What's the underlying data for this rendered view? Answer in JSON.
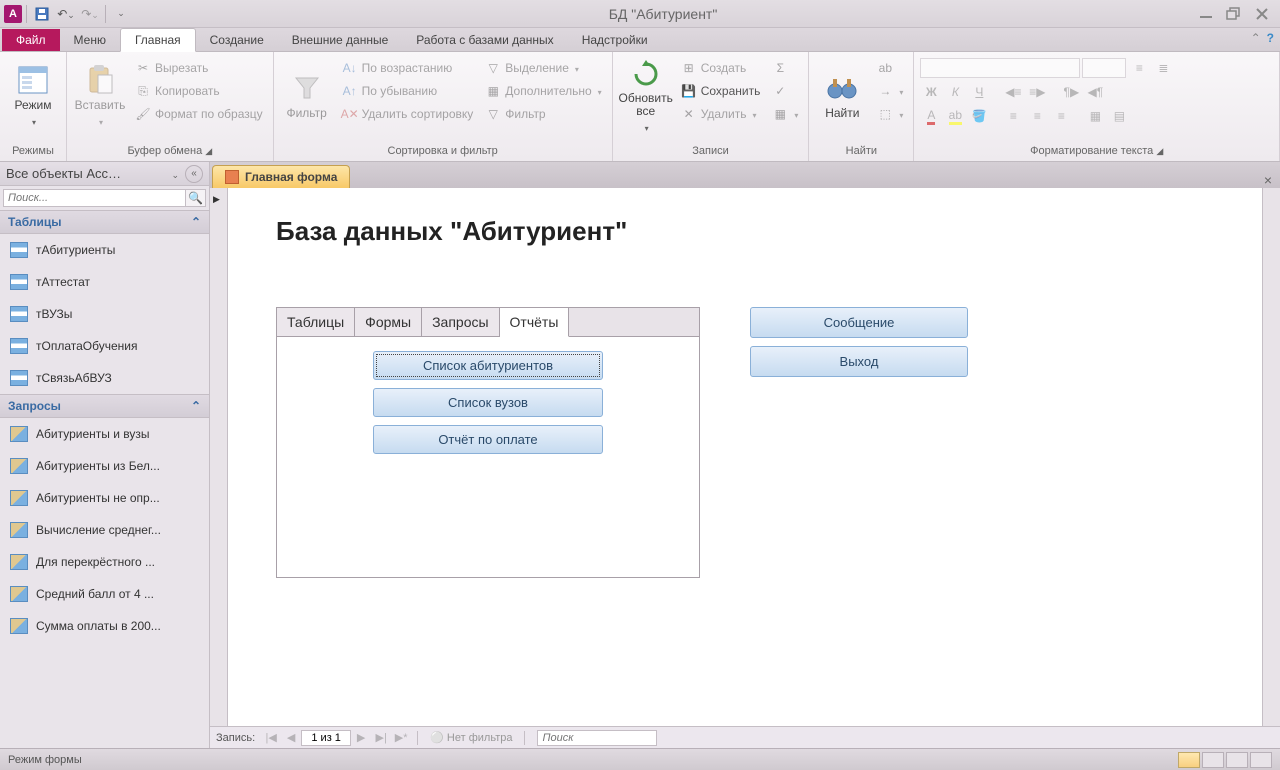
{
  "titlebar": {
    "app_letter": "A",
    "title": "БД \"Абитуриент\""
  },
  "ribbon_tabs": {
    "file": "Файл",
    "menu": "Меню",
    "home": "Главная",
    "create": "Создание",
    "external": "Внешние данные",
    "dbtools": "Работа с базами данных",
    "addins": "Надстройки"
  },
  "ribbon": {
    "modes": {
      "label": "Режимы",
      "btn": "Режим"
    },
    "clipboard": {
      "label": "Буфер обмена",
      "paste": "Вставить",
      "cut": "Вырезать",
      "copy": "Копировать",
      "painter": "Формат по образцу"
    },
    "sortfilter": {
      "label": "Сортировка и фильтр",
      "filter": "Фильтр",
      "asc": "По возрастанию",
      "desc": "По убыванию",
      "clear": "Удалить сортировку",
      "selection": "Выделение",
      "advanced": "Дополнительно",
      "toggle": "Фильтр"
    },
    "records": {
      "label": "Записи",
      "refresh": "Обновить\nвсе",
      "new": "Создать",
      "save": "Сохранить",
      "delete": "Удалить"
    },
    "find": {
      "label": "Найти",
      "find": "Найти"
    },
    "textfmt": {
      "label": "Форматирование текста"
    }
  },
  "nav": {
    "header": "Все объекты Acc…",
    "search_placeholder": "Поиск...",
    "groups": {
      "tables": {
        "label": "Таблицы",
        "items": [
          "тАбитуриенты",
          "тАттестат",
          "тВУЗы",
          "тОплатаОбучения",
          "тСвязьАбВУЗ"
        ]
      },
      "queries": {
        "label": "Запросы",
        "items": [
          "Абитуриенты и вузы",
          "Абитуриенты из Бел...",
          "Абитуриенты не опр...",
          "Вычисление среднег...",
          "Для перекрёстного ...",
          "Средний балл от 4 ...",
          "Сумма оплаты в 200..."
        ]
      }
    }
  },
  "form": {
    "tab_label": "Главная форма",
    "title": "База данных \"Абитуриент\"",
    "tabs": [
      "Таблицы",
      "Формы",
      "Запросы",
      "Отчёты"
    ],
    "report_buttons": [
      "Список абитуриентов",
      "Список вузов",
      "Отчёт по оплате"
    ],
    "side_buttons": [
      "Сообщение",
      "Выход"
    ]
  },
  "recordnav": {
    "label": "Запись:",
    "pos": "1 из 1",
    "nofilter": "Нет фильтра",
    "search": "Поиск"
  },
  "status": {
    "mode": "Режим формы"
  }
}
